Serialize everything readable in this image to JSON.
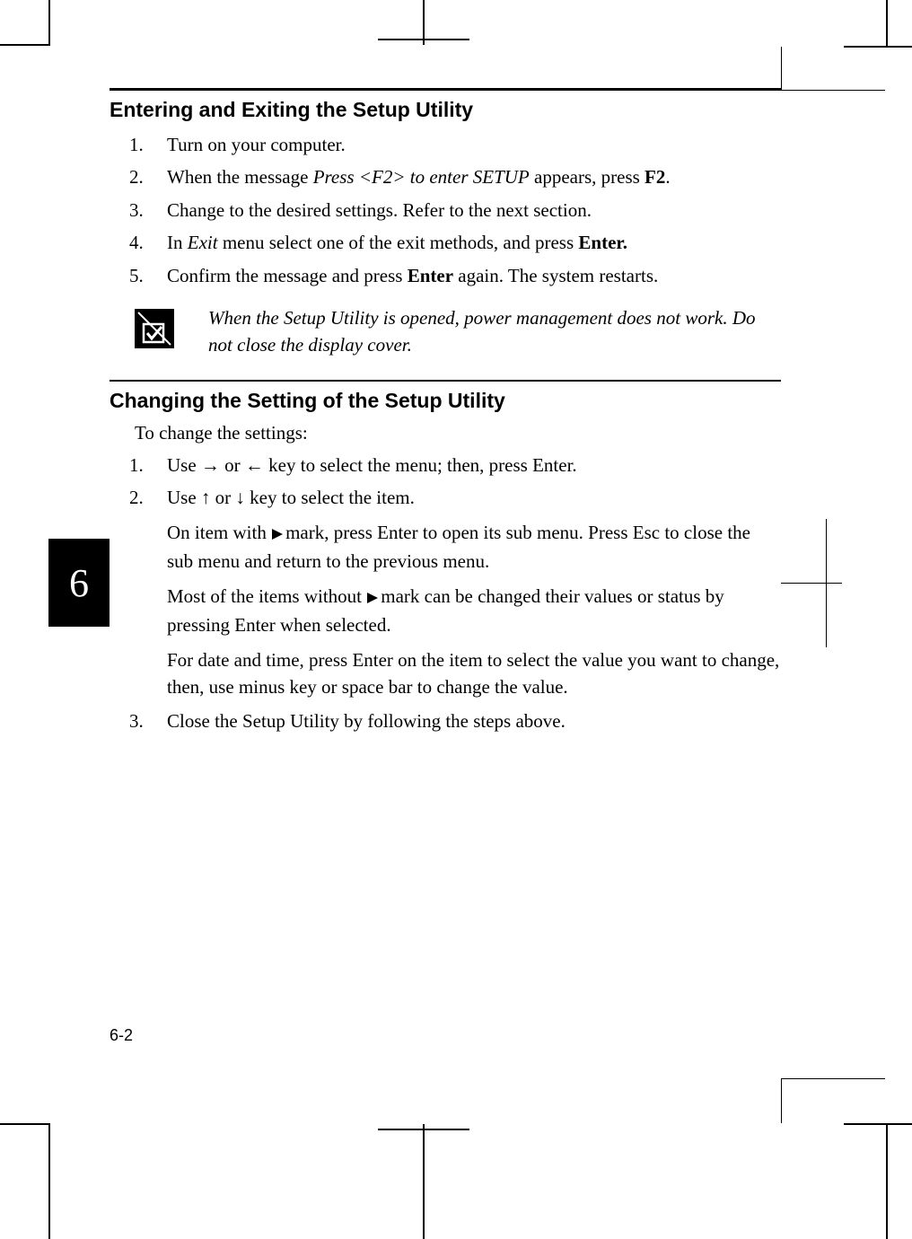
{
  "chapter_tab": "6",
  "page_number": "6-2",
  "section1": {
    "heading": "Entering and Exiting the Setup Utility",
    "steps": [
      {
        "num": "1.",
        "parts": [
          {
            "t": "Turn on your computer."
          }
        ]
      },
      {
        "num": "2.",
        "parts": [
          {
            "t": "When the message "
          },
          {
            "t": "Press <F2> to enter SETUP",
            "it": true
          },
          {
            "t": " appears, press "
          },
          {
            "t": "F2",
            "b": true
          },
          {
            "t": "."
          }
        ]
      },
      {
        "num": "3.",
        "parts": [
          {
            "t": "Change to the desired settings. Refer to the next section."
          }
        ]
      },
      {
        "num": "4.",
        "parts": [
          {
            "t": "In "
          },
          {
            "t": "Exit",
            "it": true
          },
          {
            "t": " menu select one of the exit methods, and press "
          },
          {
            "t": "Enter.",
            "b": true
          }
        ]
      },
      {
        "num": "5.",
        "parts": [
          {
            "t": "Confirm the message and press "
          },
          {
            "t": "Enter",
            "b": true
          },
          {
            "t": " again. The system restarts."
          }
        ]
      }
    ],
    "note": "When the Setup Utility is opened, power management does not work. Do not close the display cover."
  },
  "section2": {
    "heading": "Changing the Setting of the Setup Utility",
    "intro": "To change the settings:",
    "step1": {
      "num": "1.",
      "pre": "Use ",
      "arrow1": "→",
      "mid": " or ",
      "arrow2": "←",
      "post": " key to select the menu; then, press Enter."
    },
    "step2": {
      "num": "2.",
      "pre": "Use ",
      "arrow1": "↑",
      "mid": " or ",
      "arrow2": "↓",
      "post": " key to select the item."
    },
    "sub1_a": "On item with ",
    "sub1_b": "mark, press Enter to open its sub menu. Press Esc to close the sub menu and return to the previous menu.",
    "sub2_a": "Most of the items without ",
    "sub2_b": "mark can be changed their values or status by pressing Enter when selected.",
    "sub3": "For date and time, press Enter on the item to select the value you want to change, then, use minus key or space bar to change the value.",
    "step3": {
      "num": "3.",
      "text": "Close the Setup Utility by following the steps above."
    }
  }
}
